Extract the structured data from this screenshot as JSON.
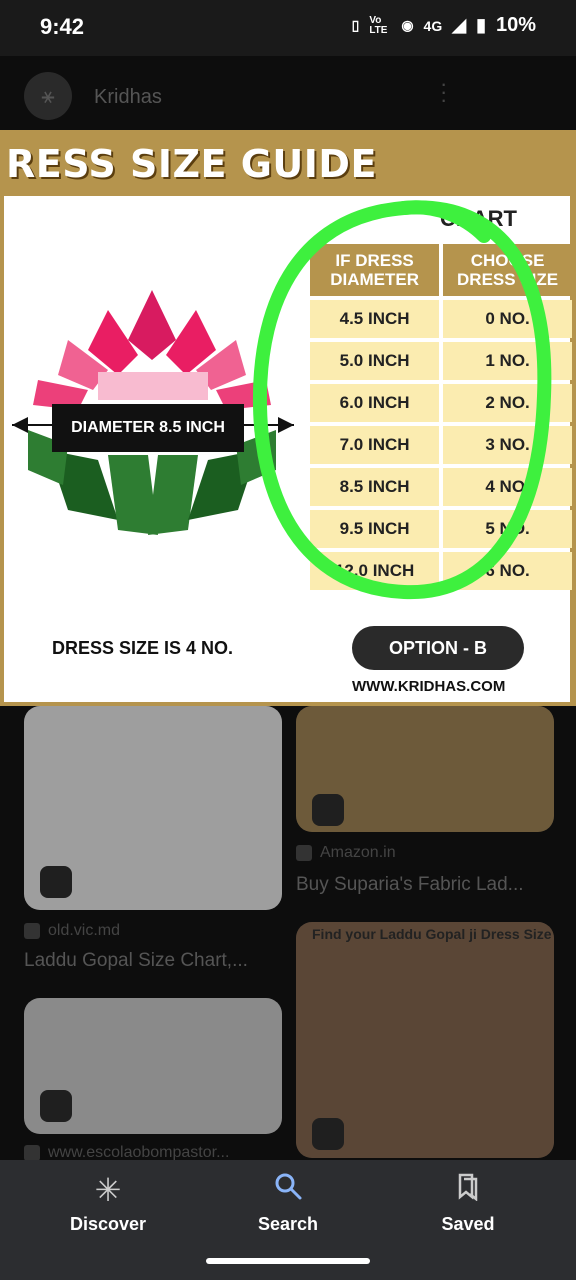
{
  "status_bar": {
    "time": "9:42",
    "network": "4G",
    "volte": "Vo LTE",
    "battery": "10%"
  },
  "header": {
    "site_name": "Kridhas"
  },
  "main_image": {
    "title": "RESS SIZE GUIDE",
    "chart_label": "CHART",
    "table_headers": [
      "IF DRESS DIAMETER",
      "CHOOSE DRESS SIZE"
    ],
    "rows": [
      [
        "4.5 INCH",
        "0 NO."
      ],
      [
        "5.0 INCH",
        "1 NO."
      ],
      [
        "6.0 INCH",
        "2 NO."
      ],
      [
        "7.0 INCH",
        "3 NO."
      ],
      [
        "8.5 INCH",
        "4 NO."
      ],
      [
        "9.5 INCH",
        "5 NO."
      ],
      [
        "12.0 INCH",
        "6 NO."
      ]
    ],
    "diameter_tag": "DIAMETER 8.5 INCH",
    "dress_size_text": "DRESS SIZE IS 4 NO.",
    "option_label": "OPTION - B",
    "url": "WWW.KRIDHAS.COM",
    "colors": {
      "gold": "#b5944d",
      "cell": "#fbecb0",
      "highlight_circle": "#3ef03e"
    }
  },
  "results": [
    {
      "source": "old.vic.md",
      "title": "Laddu Gopal Size Chart,..."
    },
    {
      "source": "Amazon.in",
      "title": "Buy Suparia's Fabric Lad..."
    },
    {
      "source": "www.escolaobompastor...",
      "title": ""
    },
    {
      "source": "",
      "title": "Find your Laddu Gopal ji Dress Size"
    }
  ],
  "bottom_nav": {
    "items": [
      {
        "label": "Discover",
        "icon": "asterisk-icon"
      },
      {
        "label": "Search",
        "icon": "search-icon"
      },
      {
        "label": "Saved",
        "icon": "saved-icon"
      }
    ]
  }
}
